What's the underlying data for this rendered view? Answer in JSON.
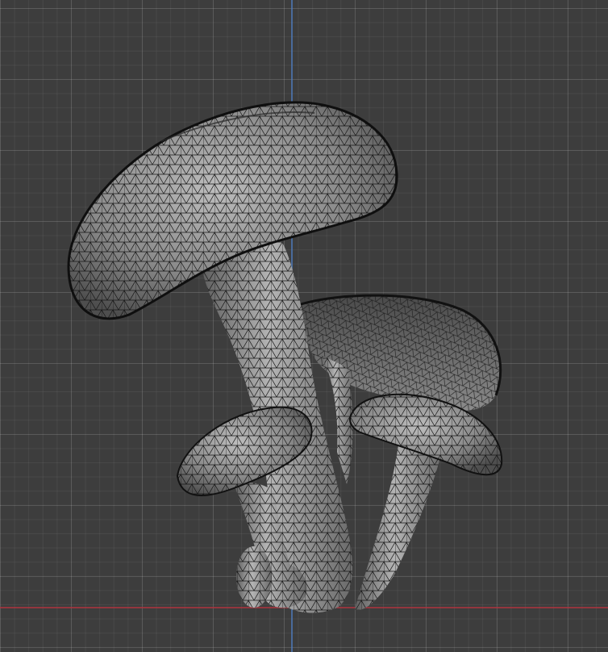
{
  "viewport": {
    "background_color": "#3d3d3d",
    "grid_color": "#4a4a4a",
    "y_axis_color": "#4f7fc4",
    "x_axis_color": "#b0343f"
  },
  "object": {
    "icon": "mushroom-cluster-mesh",
    "display_mode": "wireframe-over-solid",
    "mesh_color": "#8f8f8f",
    "wire_color": "#1a1a1a"
  }
}
